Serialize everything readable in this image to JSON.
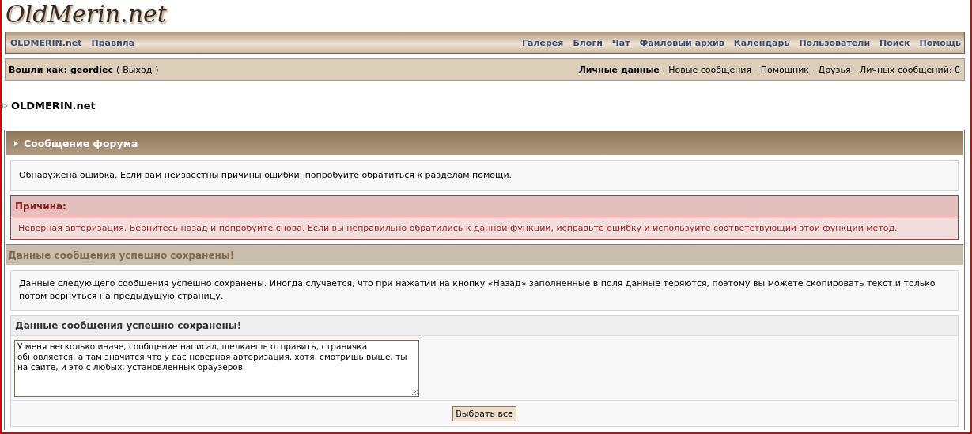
{
  "logo": "OldMerin.net",
  "navbar": {
    "left": [
      "OLDMERIN.net",
      "Правила"
    ],
    "right": [
      "Галерея",
      "Блоги",
      "Чат",
      "Файловый архив",
      "Календарь",
      "Пользователи",
      "Поиск",
      "Помощь"
    ]
  },
  "userbar": {
    "label": "Вошли как:",
    "username": "geordiec",
    "open_paren": "(",
    "logout": "Выход",
    "close_paren": ")",
    "links": [
      {
        "label": "Личные данные",
        "bold": true
      },
      {
        "label": "Новые сообщения",
        "bold": false
      },
      {
        "label": "Помощник",
        "bold": false
      },
      {
        "label": "Друзья",
        "bold": false
      },
      {
        "label": "Личных сообщений: 0",
        "bold": false
      }
    ],
    "separator": "·"
  },
  "breadcrumb": {
    "arrow": "▷",
    "title": "OLDMERIN.net"
  },
  "panel": {
    "title": "Сообщение форума",
    "intro": {
      "text": "Обнаружена ошибка. Если вам неизвестны причины ошибки, попробуйте обратиться к",
      "link": "разделам помощи",
      "end": "."
    },
    "reason": {
      "title": "Причина:",
      "text": "Неверная авторизация. Вернитесь назад и попробуйте снова. Если вы неправильно обратились к данной функции, исправьте ошибку и используйте соответствующий этой функции метод."
    }
  },
  "saved": {
    "title": "Данные сообщения успешно сохранены!",
    "text": "Данные следующего сообщения успешно сохранены. Иногда случается, что при нажатии на кнопку «Назад» заполненные в поля данные теряются, поэтому вы можете скопировать текст и только потом вернуться на предыдущую страницу.",
    "box_title": "Данные сообщения успешно сохранены!",
    "message": "У меня несколько иначе, сообщение написал, щелкаешь отправить, страничка обновляется, а там значится что у вас неверная авторизация, хотя, смотришь выше, ты на сайте, и это с любых, установленных браузеров.",
    "button": "Выбрать все"
  }
}
